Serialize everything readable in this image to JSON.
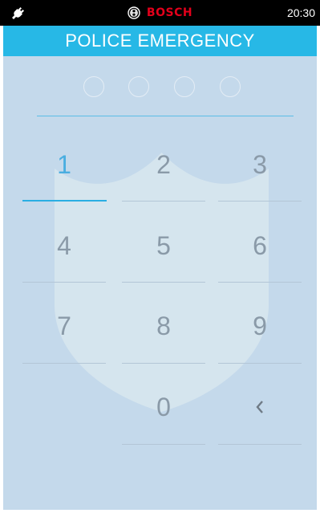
{
  "status_bar": {
    "brand": "BOSCH",
    "time": "20:30",
    "icons": {
      "left": "plug-icon",
      "brand_logo": "bosch-logo-icon"
    }
  },
  "title": "POLICE EMERGENCY",
  "pin": {
    "entered_digits": 0,
    "length": 4
  },
  "keypad": {
    "keys": [
      "1",
      "2",
      "3",
      "4",
      "5",
      "6",
      "7",
      "8",
      "9",
      "0"
    ],
    "active_key": "1",
    "backspace_icon": "chevron-left-icon"
  },
  "colors": {
    "title_bar": "#27b8e6",
    "panel": "#c4d9eb",
    "accent": "#2aaee3",
    "brand": "#e3001b"
  }
}
